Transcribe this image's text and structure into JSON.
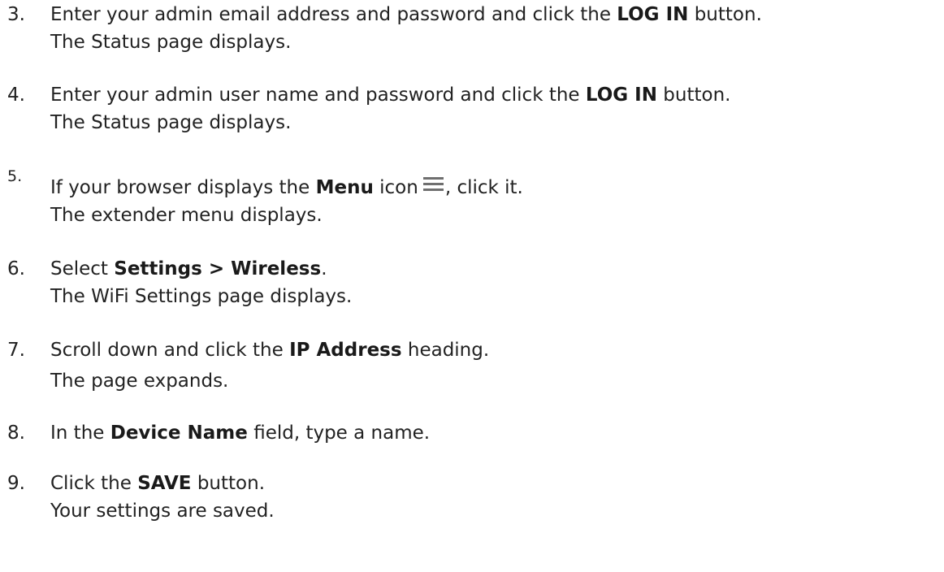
{
  "steps": [
    {
      "number": "3.",
      "pre": "Enter your admin email address and password and click the ",
      "bold": "LOG IN",
      "post": " button.",
      "result": "The Status page displays."
    },
    {
      "number": "4.",
      "pre": "Enter your admin user name and password and click the ",
      "bold": "LOG IN",
      "post": " button.",
      "result": "The Status page displays."
    },
    {
      "number": "5.",
      "pre": "If your browser displays the ",
      "bold": "Menu",
      "mid": " icon",
      "icon": "menu-hamburger-icon",
      "post": ", click it.",
      "result": "The extender menu displays."
    },
    {
      "number": "6.",
      "pre": "Select ",
      "bold": "Settings > Wireless",
      "post": ".",
      "result": "The WiFi Settings page displays."
    },
    {
      "number": "7.",
      "pre": "Scroll down and click the ",
      "bold": "IP Address",
      "post": " heading.",
      "result": "The page expands."
    },
    {
      "number": "8.",
      "pre": "In the ",
      "bold": "Device Name",
      "post": " field, type a name.",
      "result": ""
    },
    {
      "number": "9.",
      "pre": "Click the ",
      "bold": "SAVE",
      "post": " button.",
      "result": "Your settings are saved."
    }
  ],
  "colors": {
    "text": "#222222",
    "icon": "#6f6f6f"
  }
}
